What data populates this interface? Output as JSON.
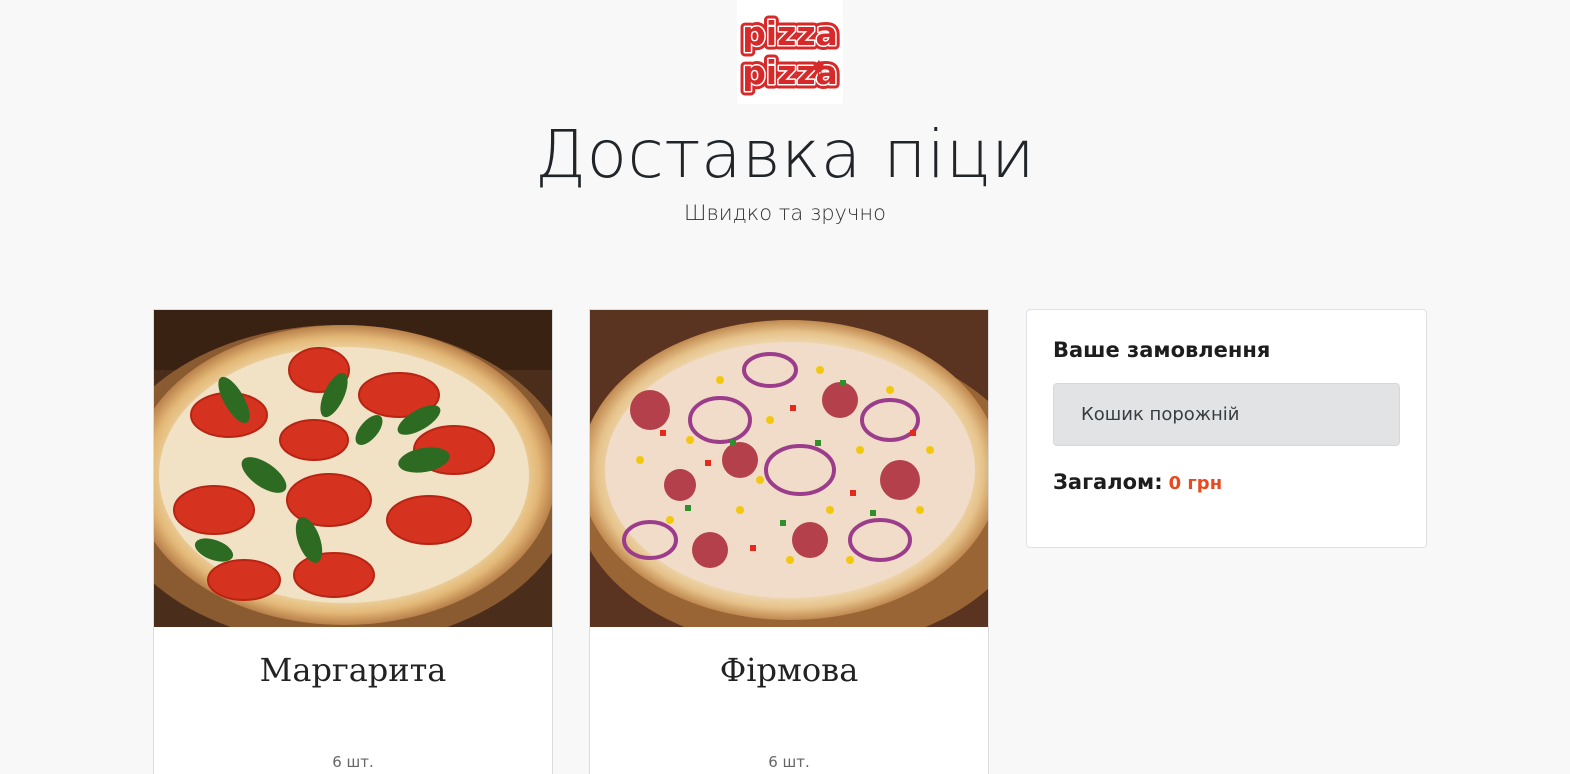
{
  "header": {
    "logo_text_line1": "pizza",
    "logo_text_line2": "pizza",
    "title": "Доставка піци",
    "subtitle": "Швидко та зручно"
  },
  "products": [
    {
      "name": "Маргарита",
      "quantity": "6 шт."
    },
    {
      "name": "Фірмова",
      "quantity": "6 шт."
    }
  ],
  "order": {
    "heading": "Ваше замовлення",
    "empty_cart": "Кошик порожній",
    "total_label": "Загалом:",
    "total_value": "0 грн"
  },
  "colors": {
    "brand_red": "#d62a2a",
    "accent_total": "#e8491d",
    "background": "#f7f8f7"
  }
}
